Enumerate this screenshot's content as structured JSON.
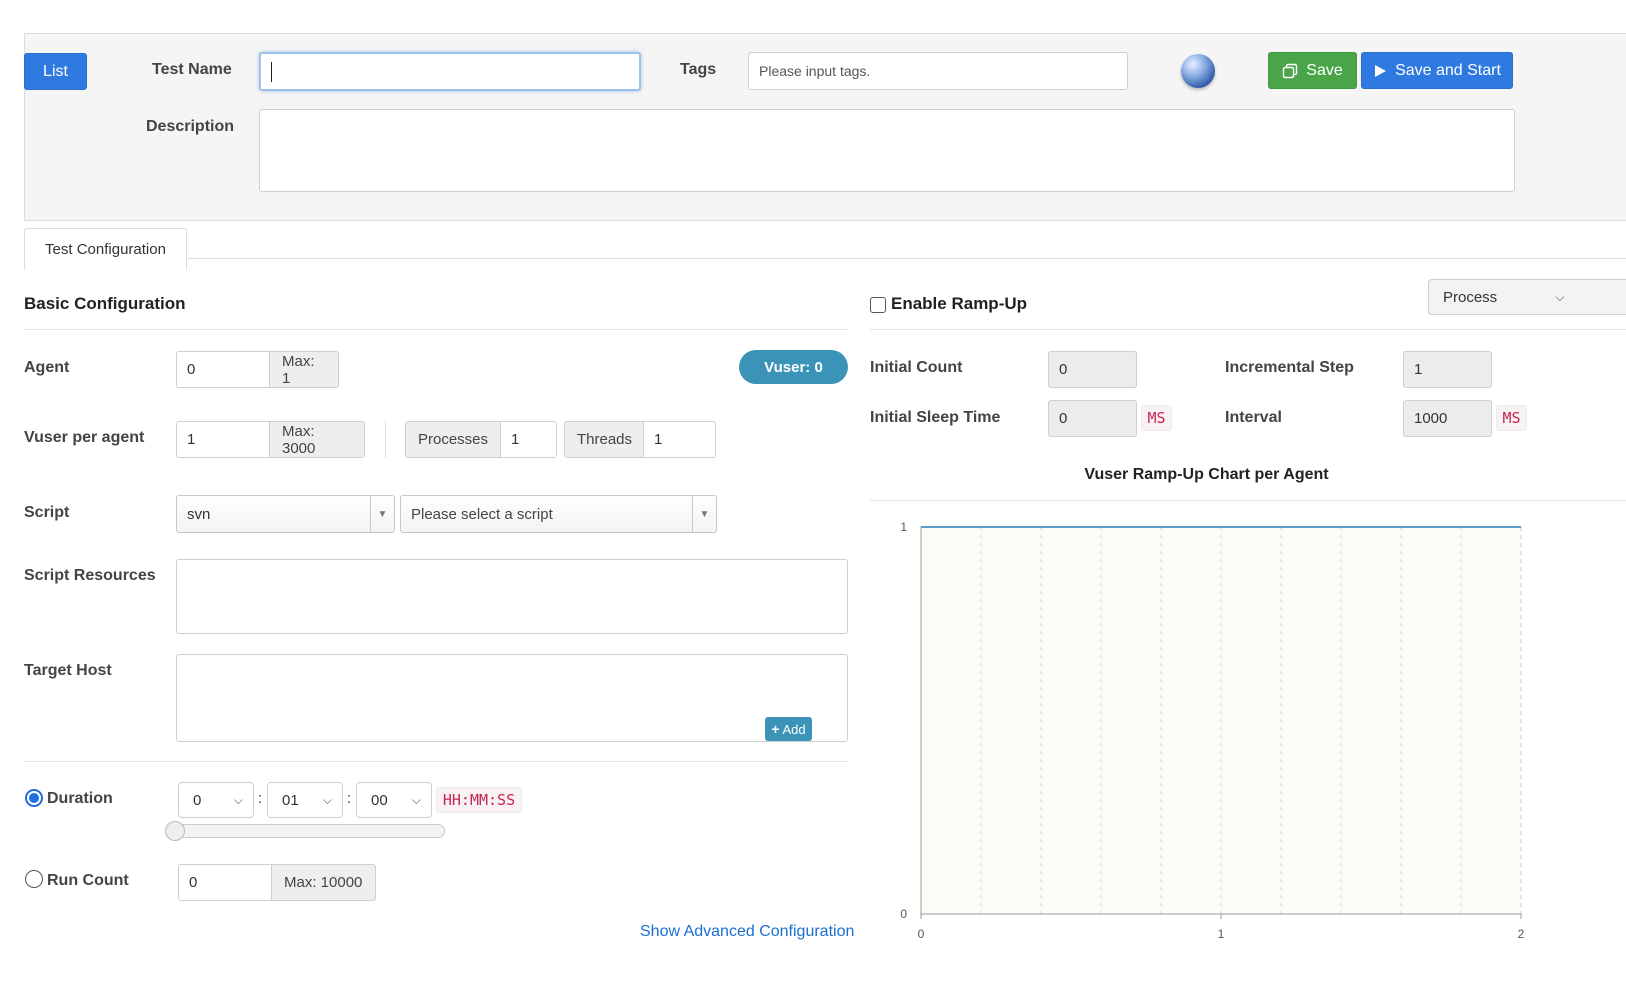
{
  "header": {
    "list_button": "List",
    "test_name_label": "Test Name",
    "test_name_value": "",
    "tags_label": "Tags",
    "tags_placeholder": "Please input tags.",
    "description_label": "Description",
    "description_value": "",
    "save_button": "Save",
    "save_start_button": "Save and Start"
  },
  "tabs": [
    {
      "label": "Test Configuration"
    }
  ],
  "basic": {
    "title": "Basic Configuration",
    "agent_label": "Agent",
    "agent_value": "0",
    "agent_max": "Max: 1",
    "vuser_badge": "Vuser: 0",
    "vuser_label": "Vuser per agent",
    "vuser_value": "1",
    "vuser_max": "Max: 3000",
    "processes_label": "Processes",
    "processes_value": "1",
    "threads_label": "Threads",
    "threads_value": "1",
    "script_label": "Script",
    "script_repo": "svn",
    "script_placeholder": "Please select a script",
    "resources_label": "Script Resources",
    "target_host_label": "Target Host",
    "add_button": "Add",
    "duration_label": "Duration",
    "duration_hours": "0",
    "duration_minutes": "01",
    "duration_seconds": "00",
    "duration_format": "HH:MM:SS",
    "duration_slider_fraction": 0.0,
    "runcount_label": "Run Count",
    "runcount_value": "0",
    "runcount_max": "Max: 10000",
    "advanced_link": "Show Advanced Configuration",
    "duration_selected": true
  },
  "rampup": {
    "enable_label": "Enable Ramp-Up",
    "enabled": false,
    "mode_select": "Process",
    "initial_count_label": "Initial Count",
    "initial_count_value": "0",
    "incremental_step_label": "Incremental Step",
    "incremental_step_value": "1",
    "initial_sleep_label": "Initial Sleep Time",
    "initial_sleep_value": "0",
    "initial_sleep_unit": "MS",
    "interval_label": "Interval",
    "interval_value": "1000",
    "interval_unit": "MS",
    "chart_title": "Vuser Ramp-Up Chart per Agent"
  },
  "colors": {
    "primary": "#2f7ae0",
    "success": "#4aa548",
    "badge": "#3b93b8",
    "chart_line": "#5b9bc9",
    "chart_bg": "#fcfbf6"
  },
  "chart_data": {
    "type": "line",
    "title": "Vuser Ramp-Up Chart per Agent",
    "x": [
      0,
      2
    ],
    "series": [
      {
        "values": [
          1,
          1
        ]
      }
    ],
    "xlim": [
      0,
      2
    ],
    "ylim": [
      0,
      1
    ],
    "x_ticks": [
      "0",
      "1",
      "2"
    ],
    "y_ticks": [
      "0",
      "1"
    ],
    "grid": true
  }
}
